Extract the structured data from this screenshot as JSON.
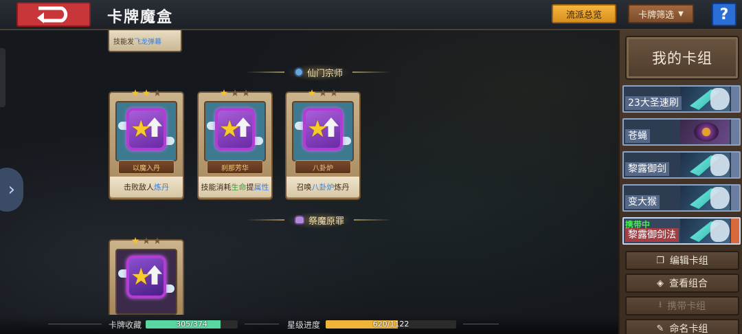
{
  "header": {
    "title": "卡牌魔盒",
    "overview_label": "流派总览",
    "filter_label": "卡牌筛选",
    "help_label": "?"
  },
  "top_card": {
    "desc_prefix": "技能发",
    "desc_keyword": "飞龙弹幕"
  },
  "sections": [
    {
      "label": "仙门宗师",
      "icon": "gem-icon",
      "cards": [
        {
          "name": "以魔入丹",
          "desc_html": [
            {
              "t": "击败敌人",
              "c": ""
            },
            {
              "t": "炼丹",
              "c": "kw"
            }
          ],
          "stars_lit": 2,
          "stars_total": 3
        },
        {
          "name": "刹那芳华",
          "desc_html": [
            {
              "t": "技能消耗",
              "c": ""
            },
            {
              "t": "生命",
              "c": "kw-g"
            },
            {
              "t": "提",
              "c": ""
            },
            {
              "t": "属性",
              "c": "kw"
            }
          ],
          "stars_lit": 1,
          "stars_total": 3
        },
        {
          "name": "八卦炉",
          "desc_html": [
            {
              "t": "召唤",
              "c": ""
            },
            {
              "t": "八卦炉",
              "c": "kw"
            },
            {
              "t": "炼丹",
              "c": ""
            }
          ],
          "stars_lit": 1,
          "stars_total": 3
        }
      ]
    },
    {
      "label": "祭魔原罪",
      "icon": "demon-icon",
      "cards": [
        {
          "name": "",
          "desc_html": [],
          "stars_lit": 1,
          "stars_total": 3
        }
      ]
    }
  ],
  "bottom": {
    "collection_label": "卡牌收藏",
    "collection_value": "305/374",
    "collection_fraction": 0.8155,
    "star_label": "星级进度",
    "star_value": "620/1122",
    "star_fraction": 0.5526
  },
  "right_panel": {
    "title": "我的卡组",
    "decks": [
      {
        "name": "23大圣速刷",
        "art": "sword-icon",
        "active": false
      },
      {
        "name": "苍蝇",
        "art": "fly-icon",
        "active": false
      },
      {
        "name": "黎露御剑",
        "art": "sword-icon",
        "active": false
      },
      {
        "name": "变大猴",
        "art": "sword-icon",
        "active": false
      },
      {
        "name": "黎露御剑法",
        "art": "sword-icon",
        "active": true,
        "tag": "携带中"
      }
    ],
    "buttons": [
      {
        "label": "编辑卡组",
        "icon": "copy-icon",
        "disabled": false
      },
      {
        "label": "查看组合",
        "icon": "eye-icon",
        "disabled": false
      },
      {
        "label": "携带卡组",
        "icon": "download-icon",
        "disabled": true
      },
      {
        "label": "命名卡组",
        "icon": "pencil-icon",
        "disabled": false
      }
    ]
  },
  "colors": {
    "back_button": "#c8363a",
    "orange_button": "#f4b640",
    "help_button": "#2b6fd6",
    "collection_bar": "#5ad6a0",
    "star_bar": "#f0b437",
    "active_tag": "#3ef048"
  }
}
